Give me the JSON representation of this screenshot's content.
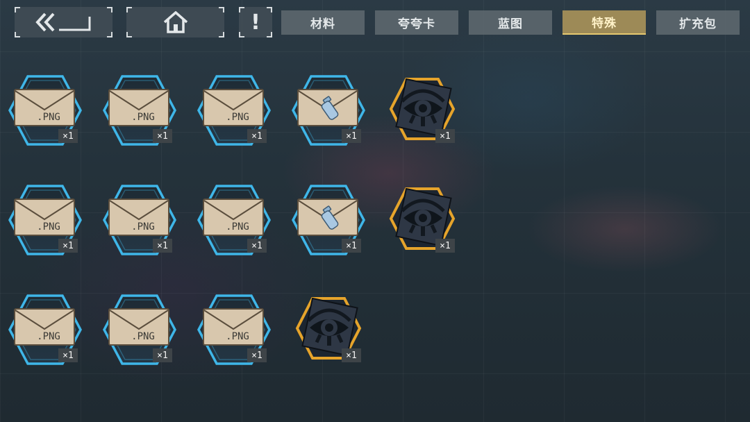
{
  "nav": {
    "back_icon": "double-chevron-left-icon",
    "home_icon": "home-icon",
    "info_icon": "exclamation-icon",
    "info_label": "!"
  },
  "tabs": [
    {
      "label": "材料",
      "active": false
    },
    {
      "label": "夸夸卡",
      "active": false
    },
    {
      "label": "蓝图",
      "active": false
    },
    {
      "label": "特殊",
      "active": true
    },
    {
      "label": "扩充包",
      "active": false
    }
  ],
  "colors": {
    "accent_gold": "#e6a42b",
    "accent_blue": "#3fb6e8",
    "active_tab": "#9d8a57"
  },
  "items": [
    {
      "type": "envelope-png",
      "label": ".PNG",
      "count": "×1"
    },
    {
      "type": "envelope-png",
      "label": ".PNG",
      "count": "×1"
    },
    {
      "type": "envelope-png",
      "label": ".PNG",
      "count": "×1"
    },
    {
      "type": "envelope-bottle",
      "label": "",
      "count": "×1"
    },
    {
      "type": "eye-emblem",
      "label": "",
      "count": "×1"
    },
    {
      "type": "envelope-png",
      "label": ".PNG",
      "count": "×1"
    },
    {
      "type": "envelope-png",
      "label": ".PNG",
      "count": "×1"
    },
    {
      "type": "envelope-png",
      "label": ".PNG",
      "count": "×1"
    },
    {
      "type": "envelope-bottle",
      "label": "",
      "count": "×1"
    },
    {
      "type": "eye-emblem",
      "label": "",
      "count": "×1"
    },
    {
      "type": "envelope-png",
      "label": ".PNG",
      "count": "×1"
    },
    {
      "type": "envelope-png",
      "label": ".PNG",
      "count": "×1"
    },
    {
      "type": "envelope-png",
      "label": ".PNG",
      "count": "×1"
    },
    {
      "type": "eye-emblem",
      "label": "",
      "count": "×1"
    }
  ]
}
